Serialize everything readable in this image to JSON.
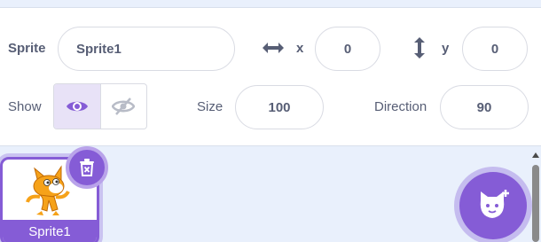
{
  "sprite_info": {
    "sprite_label": "Sprite",
    "sprite_name": "Sprite1",
    "x_label": "x",
    "x_value": "0",
    "y_label": "y",
    "y_value": "0",
    "show_label": "Show",
    "size_label": "Size",
    "size_value": "100",
    "direction_label": "Direction",
    "direction_value": "90"
  },
  "sprite_list": {
    "items": [
      {
        "label": "Sprite1",
        "selected": true
      }
    ]
  },
  "icons": {
    "horizontal": "arrow-left-right-icon",
    "vertical": "arrow-up-down-icon",
    "show": "eye-icon",
    "hide": "eye-slash-icon",
    "delete": "trash-icon",
    "add_sprite": "cat-add-icon"
  },
  "colors": {
    "accent": "#855cd6",
    "text": "#575e75",
    "panel_bg": "#e9f0fc"
  }
}
